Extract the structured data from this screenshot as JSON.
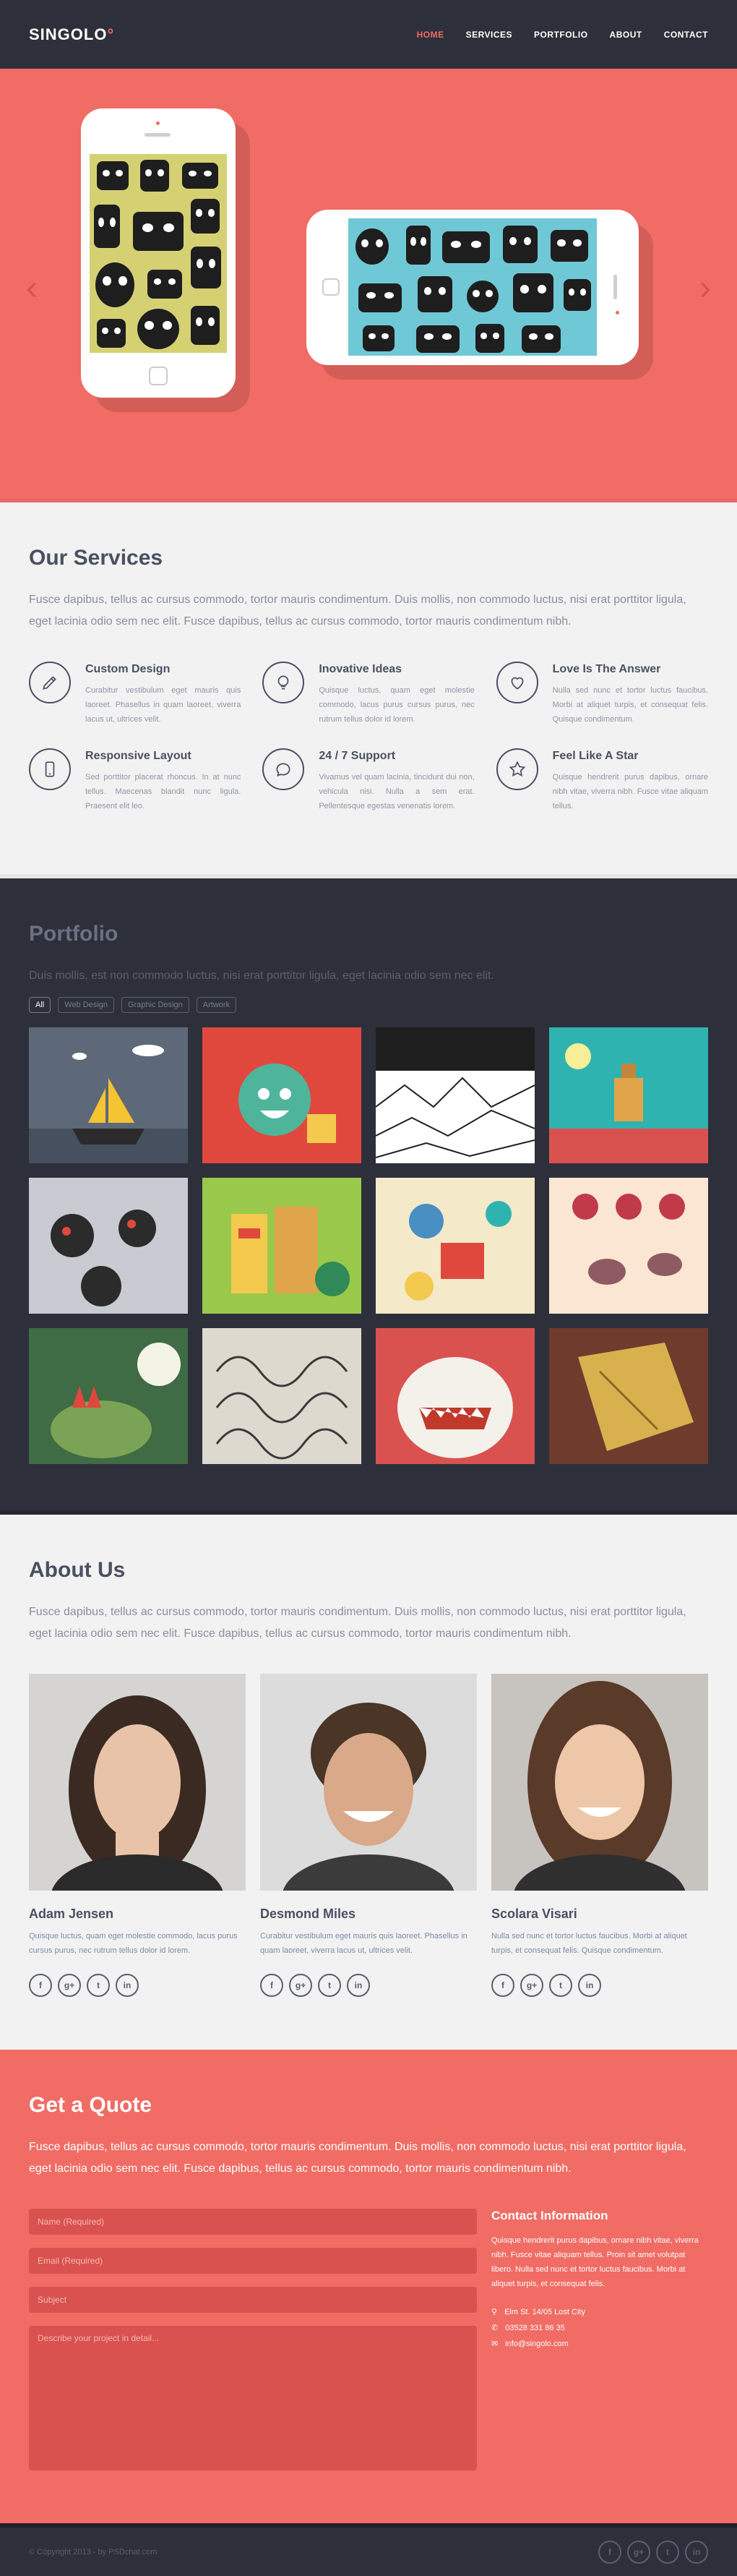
{
  "header": {
    "logo": "SINGOLO",
    "nav": [
      "HOME",
      "SERVICES",
      "PORTFOLIO",
      "ABOUT",
      "CONTACT"
    ],
    "active_nav": "HOME",
    "accent_color": "#f06c64"
  },
  "slider": {
    "bg_color": "#f06c64",
    "prev_icon": "chevron-left-icon",
    "next_icon": "chevron-right-icon"
  },
  "services": {
    "title": "Our Services",
    "lead": "Fusce dapibus, tellus ac cursus commodo, tortor mauris condimentum. Duis mollis, non commodo luctus, nisi erat porttitor ligula, eget lacinia odio sem nec elit. Fusce dapibus, tellus ac cursus commodo, tortor mauris condimentum nibh.",
    "items": [
      {
        "icon": "pencil-icon",
        "title": "Custom Design",
        "text": "Curabitur vestibulum eget mauris quis laoreet. Phasellus in quam laoreet, viverra lacus ut, ultrices velit."
      },
      {
        "icon": "lightbulb-icon",
        "title": "Inovative Ideas",
        "text": "Quisque luctus, quam eget molestie commodo, lacus purus cursus purus, nec rutrum tellus dolor id lorem."
      },
      {
        "icon": "heart-icon",
        "title": "Love Is The Answer",
        "text": "Nulla sed nunc et tortor luctus faucibus. Morbi at aliquet turpis, et consequat felis. Quisque condimentum."
      },
      {
        "icon": "smartphone-icon",
        "title": "Responsive Layout",
        "text": "Sed porttitor placerat rhoncus. In at nunc tellus. Maecenas blandit nunc ligula. Praesent elit leo."
      },
      {
        "icon": "chat-bubble-icon",
        "title": "24 / 7 Support",
        "text": "Vivamus vel quam lacinia, tincidunt dui non, vehicula nisi. Nulla a sem erat. Pellentesque egestas venenatis lorem."
      },
      {
        "icon": "star-icon",
        "title": "Feel Like A Star",
        "text": "Quisque hendrerit purus dapibus, ornare nibh vitae, viverra nibh. Fusce vitae aliquam tellus."
      }
    ]
  },
  "portfolio": {
    "title": "Portfolio",
    "lead": "Duis mollis, est non commodo luctus, nisi erat porttitor ligula, eget lacinia odio sem nec elit.",
    "tags": [
      "All",
      "Web Design",
      "Graphic Design",
      "Artwork"
    ],
    "active_tag": "All"
  },
  "about": {
    "title": "About Us",
    "lead": "Fusce dapibus, tellus ac cursus commodo, tortor mauris condimentum. Duis mollis, non commodo luctus, nisi erat porttitor ligula, eget lacinia odio sem nec elit. Fusce dapibus, tellus ac cursus commodo, tortor mauris condimentum nibh.",
    "team": [
      {
        "name": "Adam Jensen",
        "bio": "Quisque luctus, quam eget molestie commodo, lacus purus cursus purus, nec rutrum tellus dolor id lorem."
      },
      {
        "name": "Desmond Miles",
        "bio": "Curabitur vestibulum eget mauris quis laoreet. Phasellus in quam laoreet, viverra lacus ut, ultrices velit."
      },
      {
        "name": "Scolara Visari",
        "bio": "Nulla sed nunc et tortor luctus faucibus. Morbi at aliquet turpis, et consequat felis. Quisque condimentum."
      }
    ],
    "social": [
      "f",
      "g+",
      "t",
      "in"
    ]
  },
  "quote": {
    "title": "Get a Quote",
    "lead": "Fusce dapibus, tellus ac cursus commodo, tortor mauris condimentum. Duis mollis, non commodo luctus, nisi erat porttitor ligula, eget lacinia odio sem nec elit. Fusce dapibus, tellus ac cursus commodo, tortor mauris condimentum nibh.",
    "form": {
      "name_placeholder": "Name (Required)",
      "email_placeholder": "Email (Required)",
      "subject_placeholder": "Subject",
      "message_placeholder": "Describe your project in detail..."
    },
    "contact": {
      "title": "Contact Information",
      "text": "Quisque hendrerit purus dapibus, ornare nibh vitae, viverra nibh. Fusce vitae aliquam tellus. Proin sit amet volutpat libero. Nulla sed nunc et tortor luctus faucibus. Morbi at aliquet turpis, et consequat felis.",
      "address": "Elm St. 14/05 Lost City",
      "phone": "03528 331 86 35",
      "email": "info@singolo.com"
    }
  },
  "footer": {
    "copyright": "© Copyright 2013 - by PSDchat.com",
    "social": [
      "f",
      "g+",
      "t",
      "in"
    ]
  }
}
